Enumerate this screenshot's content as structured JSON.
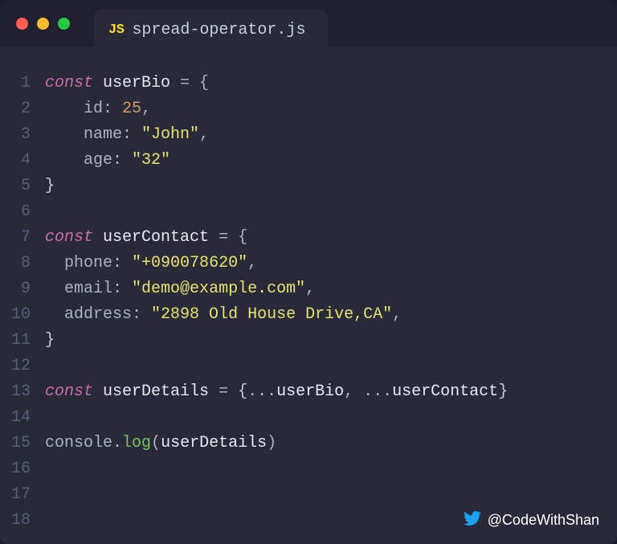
{
  "tab": {
    "badge": "JS",
    "filename": "spread-operator.js"
  },
  "lineNumbers": [
    "1",
    "2",
    "3",
    "4",
    "5",
    "6",
    "7",
    "8",
    "9",
    "10",
    "11",
    "12",
    "13",
    "14",
    "15",
    "16",
    "17",
    "18"
  ],
  "code": {
    "l1": {
      "kw": "const",
      "var": "userBio",
      "rest": " = {"
    },
    "l2": {
      "key": "id",
      "colon": ": ",
      "val": "25",
      "type": "num",
      "comma": ","
    },
    "l3": {
      "key": "name",
      "colon": ": ",
      "val": "\"John\"",
      "type": "str",
      "comma": ","
    },
    "l4": {
      "key": "age",
      "colon": ": ",
      "val": "\"32\"",
      "type": "str",
      "comma": ""
    },
    "l5": {
      "close": "}"
    },
    "l7": {
      "kw": "const",
      "var": "userContact",
      "rest": " = {"
    },
    "l8": {
      "key": "phone",
      "colon": ": ",
      "val": "\"+090078620\"",
      "type": "str",
      "comma": ","
    },
    "l9": {
      "key": "email",
      "colon": ": ",
      "val": "\"demo@example.com\"",
      "type": "str",
      "comma": ","
    },
    "l10": {
      "key": "address",
      "colon": ": ",
      "val": "\"2898 Old House Drive,CA\"",
      "type": "str",
      "comma": ","
    },
    "l11": {
      "close": "}"
    },
    "l13": {
      "kw": "const",
      "var": "userDetails",
      "eq": " = ",
      "open": "{",
      "spread1": "...",
      "ref1": "userBio",
      "sep": ", ",
      "spread2": "...",
      "ref2": "userContact",
      "closeb": "}"
    },
    "l15": {
      "obj": "console",
      "dot": ".",
      "fn": "log",
      "open": "(",
      "arg": "userDetails",
      "close": ")"
    }
  },
  "attribution": {
    "handle": "@CodeWithShan"
  }
}
